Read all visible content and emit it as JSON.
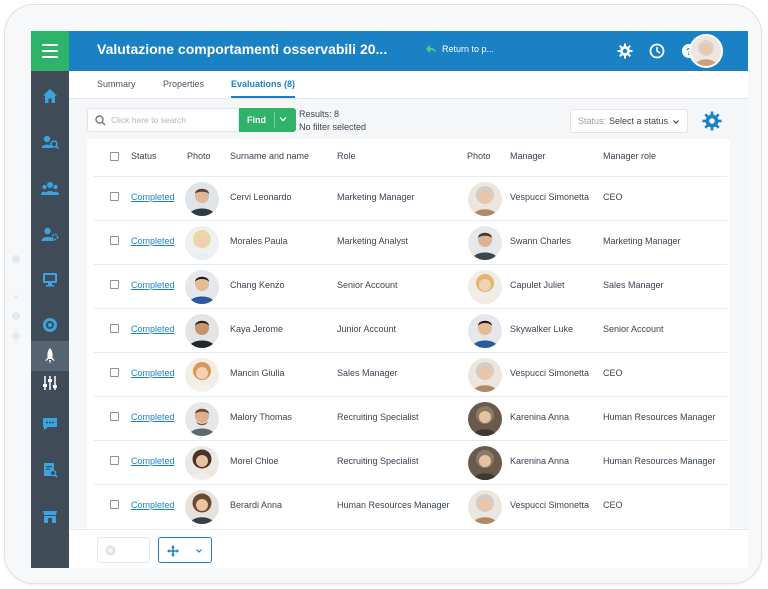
{
  "header": {
    "title": "Valutazione comportamenti osservabili 20...",
    "return_label": "Return to p...",
    "icons": [
      "gear-icon",
      "clock-icon",
      "help-icon"
    ],
    "accent_color": "#1a82c4",
    "brand_green": "#2fb26a"
  },
  "sidebar": {
    "items": [
      "home",
      "search-people",
      "team",
      "user-settings",
      "monitor",
      "target",
      "rocket",
      "sliders",
      "chat",
      "report-search",
      "store"
    ],
    "active": "rocket"
  },
  "tabs": [
    {
      "label": "Summary"
    },
    {
      "label": "Properties"
    },
    {
      "label": "Evaluations (8)"
    }
  ],
  "toolbar": {
    "search_placeholder": "Click here to search",
    "find_label": "Find",
    "results_label": "Results: 8",
    "filter_label": "No filter selected",
    "status_placeholder": "Status:",
    "status_value": "Select a status"
  },
  "table": {
    "headers": {
      "status": "Status",
      "photo": "Photo",
      "surname": "Surname and name",
      "role": "Role",
      "photo2": "Photo",
      "manager": "Manager",
      "manager_role": "Manager role"
    },
    "rows": [
      {
        "status": "Completed",
        "name": "Cervi Leonardo",
        "role": "Marketing Manager",
        "manager": "Vespucci Simonetta",
        "manager_role": "CEO"
      },
      {
        "status": "Completed",
        "name": "Morales Paula",
        "role": "Marketing Analyst",
        "manager": "Swann Charles",
        "manager_role": "Marketing Manager"
      },
      {
        "status": "Completed",
        "name": "Chang Kenzo",
        "role": "Senior Account",
        "manager": "Capulet Juliet",
        "manager_role": "Sales Manager"
      },
      {
        "status": "Completed",
        "name": "Kaya Jerome",
        "role": "Junior Account",
        "manager": "Skywalker Luke",
        "manager_role": "Senior Account"
      },
      {
        "status": "Completed",
        "name": "Mancin Giulia",
        "role": "Sales Manager",
        "manager": "Vespucci Simonetta",
        "manager_role": "CEO"
      },
      {
        "status": "Completed",
        "name": "Malory Thomas",
        "role": "Recruiting Specialist",
        "manager": "Karenina Anna",
        "manager_role": "Human Resources Manager"
      },
      {
        "status": "Completed",
        "name": "Morel Chloe",
        "role": "Recruiting Specialist",
        "manager": "Karenina Anna",
        "manager_role": "Human Resources Manager"
      },
      {
        "status": "Completed",
        "name": "Berardi Anna",
        "role": "Human Resources Manager",
        "manager": "Vespucci Simonetta",
        "manager_role": "CEO"
      }
    ]
  }
}
